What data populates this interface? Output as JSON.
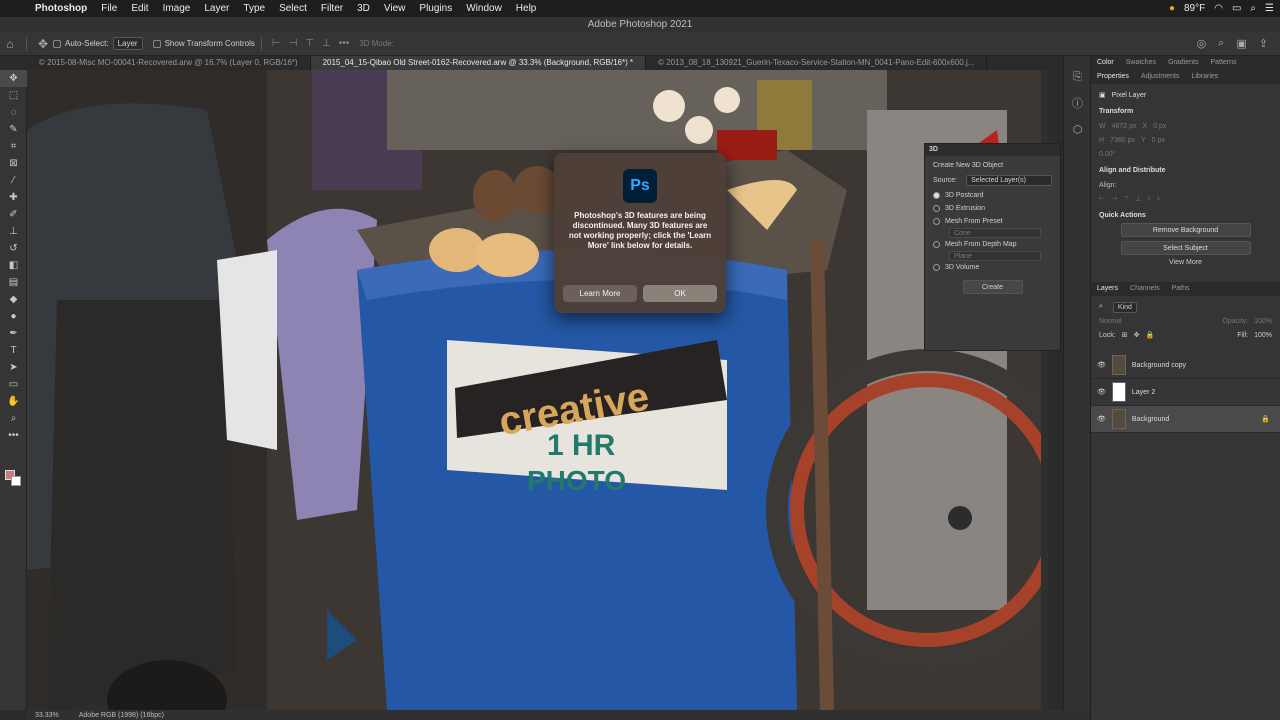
{
  "menubar": {
    "app": "Photoshop",
    "items": [
      "File",
      "Edit",
      "Image",
      "Layer",
      "Type",
      "Select",
      "Filter",
      "3D",
      "View",
      "Plugins",
      "Window",
      "Help"
    ],
    "temperature": "89°F",
    "time": ""
  },
  "window": {
    "title": "Adobe Photoshop 2021"
  },
  "options": {
    "auto_select_label": "Auto-Select:",
    "auto_select_value": "Layer",
    "transform_label": "Show Transform Controls",
    "mode_3d": "3D Mode:"
  },
  "tabs": [
    {
      "label": "© 2015-08-Misc MO-00041-Recovered.arw @ 16.7% (Layer 0, RGB/16*)"
    },
    {
      "label": "2015_04_15-Qibao Old Street-0162-Recovered.arw @ 33.3% (Background, RGB/16*) *"
    },
    {
      "label": "© 2013_08_18_130921_Guerin-Texaco-Service-Station-MN_0041-Pano-Edit-600x600.j..."
    }
  ],
  "canvas_sign": {
    "line1": "creative",
    "line2": "1 HR",
    "line3": "PHOTO"
  },
  "dialog": {
    "logo": "Ps",
    "message": "Photoshop's 3D features are being discontinued. Many 3D features are not working properly; click the 'Learn More' link below for details.",
    "learn_more": "Learn More",
    "ok": "OK"
  },
  "panel3d": {
    "title": "3D",
    "create_new": "Create New 3D Object",
    "source_label": "Source:",
    "source_value": "Selected Layer(s)",
    "options": [
      "3D Postcard",
      "3D Extrusion",
      "Mesh From Preset",
      "Mesh From Depth Map",
      "3D Volume"
    ],
    "preset_value": "Cone",
    "depth_value": "Plane",
    "create": "Create"
  },
  "rightpanel": {
    "top_tabs": [
      "Color",
      "Swatches",
      "Gradients",
      "Patterns"
    ],
    "prop_tabs": [
      "Properties",
      "Adjustments",
      "Libraries"
    ],
    "pixel_layer": "Pixel Layer",
    "transform": "Transform",
    "w": "W",
    "h": "H",
    "x": "X",
    "y": "Y",
    "w_val": "4872 px",
    "h_val": "7360 px",
    "x_val": "0 px",
    "y_val": "0 px",
    "angle": "0.00°",
    "align": "Align and Distribute",
    "align_label": "Align:",
    "quick_actions": "Quick Actions",
    "remove_bg": "Remove Background",
    "select_subject": "Select Subject",
    "view_more": "View More",
    "layer_tabs": [
      "Layers",
      "Channels",
      "Paths"
    ],
    "kind": "Kind",
    "blend": "Normal",
    "opacity_label": "Opacity:",
    "opacity": "100%",
    "lock_label": "Lock:",
    "fill_label": "Fill:",
    "fill": "100%",
    "layers": [
      {
        "name": "Background copy",
        "selected": false
      },
      {
        "name": "Layer 2",
        "selected": false
      },
      {
        "name": "Background",
        "selected": true
      }
    ]
  },
  "status": {
    "zoom": "33.33%",
    "profile": "Adobe RGB (1998) (16bpc)"
  }
}
